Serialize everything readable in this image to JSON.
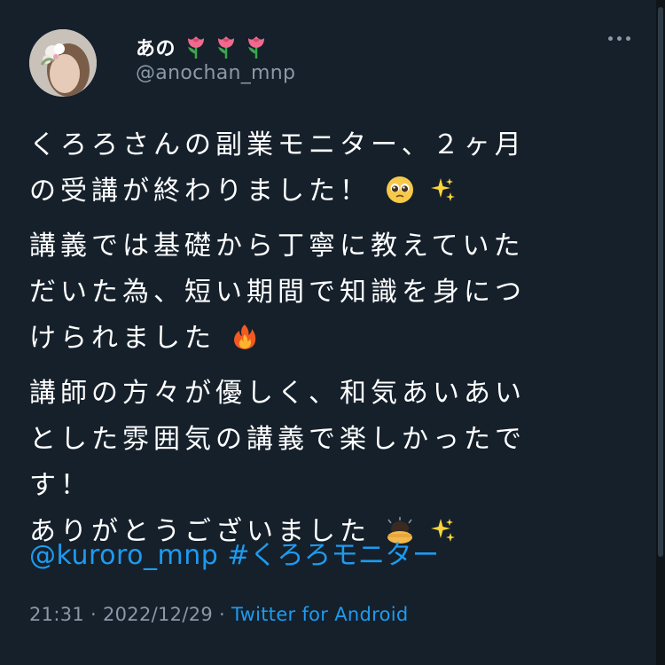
{
  "tweet": {
    "display_name": "あの",
    "name_emojis": [
      "tulip-emoji",
      "tulip-emoji",
      "tulip-emoji"
    ],
    "handle": "@anochan_mnp",
    "paragraphs": [
      [
        "くろろさんの副業モニター、２ヶ月",
        "の受講が終わりました！"
      ],
      [
        "講義では基礎から丁寧に教えていた",
        "だいた為、短い期間で知識を身につ",
        "けられました"
      ],
      [
        "講師の方々が優しく、和気あいあい",
        "とした雰囲気の講義で楽しかったで",
        "す！",
        "ありがとうございました"
      ]
    ],
    "mention": "@kuroro_mnp",
    "hashtag": "#くろろモニター",
    "time": "21:31",
    "separator": "·",
    "date": "2022/12/29",
    "source": "Twitter for Android"
  },
  "colors": {
    "background": "#15202b",
    "text": "#ffffff",
    "secondary": "#8b98a5",
    "link": "#1d9bf0"
  }
}
